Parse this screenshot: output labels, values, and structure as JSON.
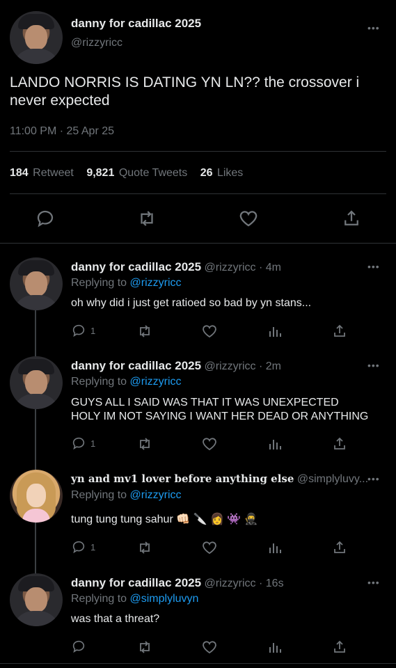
{
  "main_tweet": {
    "author_name": "danny for cadillac 2025",
    "author_handle": "@rizzyricc",
    "text_line1": "LANDO NORRIS IS DATING YN LN?? the crossover i",
    "text_line2": "never expected",
    "timestamp": "11:00 PM · 25 Apr 25",
    "retweet_count": "184",
    "retweet_label": "Retweet",
    "quote_count": "9,821",
    "quote_label": "Quote Tweets",
    "like_count": "26",
    "like_label": "Likes"
  },
  "replies": [
    {
      "author_name": "danny for cadillac 2025",
      "meta": "@rizzyricc · 4m",
      "replying_prefix": "Replying to",
      "replying_to": "@rizzyricc",
      "text_line1": "oh why did i just get ratioed so bad by yn stans...",
      "text_line2": "",
      "reply_count": "1"
    },
    {
      "author_name": "danny for cadillac 2025",
      "meta": "@rizzyricc · 2m",
      "replying_prefix": "Replying to",
      "replying_to": "@rizzyricc",
      "text_line1": "GUYS ALL I SAID WAS THAT IT WAS UNEXPECTED",
      "text_line2": "HOLY IM NOT SAYING I WANT HER DEAD OR ANYTHING",
      "reply_count": "1"
    },
    {
      "author_name": "yn and mv1 lover before anything else",
      "meta": "@simplyluvy...",
      "replying_prefix": "Replying to",
      "replying_to": "@rizzyricc",
      "text_line1": "tung tung tung sahur 👊🏻 🔪 👩 👾 🥷",
      "text_line2": "",
      "reply_count": "1"
    },
    {
      "author_name": "danny for cadillac 2025",
      "meta": "@rizzyricc · 16s",
      "replying_prefix": "Replying to",
      "replying_to": "@simplyluvyn",
      "text_line1": "was that a threat?",
      "text_line2": "",
      "reply_count": ""
    }
  ],
  "more_glyph": "•••",
  "colors": {
    "background": "#000000",
    "text": "#e7e9ea",
    "muted": "#71767b",
    "link": "#1d9bf0",
    "divider": "#2f3336"
  },
  "icons": [
    "reply-icon",
    "retweet-icon",
    "like-icon",
    "share-icon",
    "analytics-icon",
    "more-icon"
  ]
}
